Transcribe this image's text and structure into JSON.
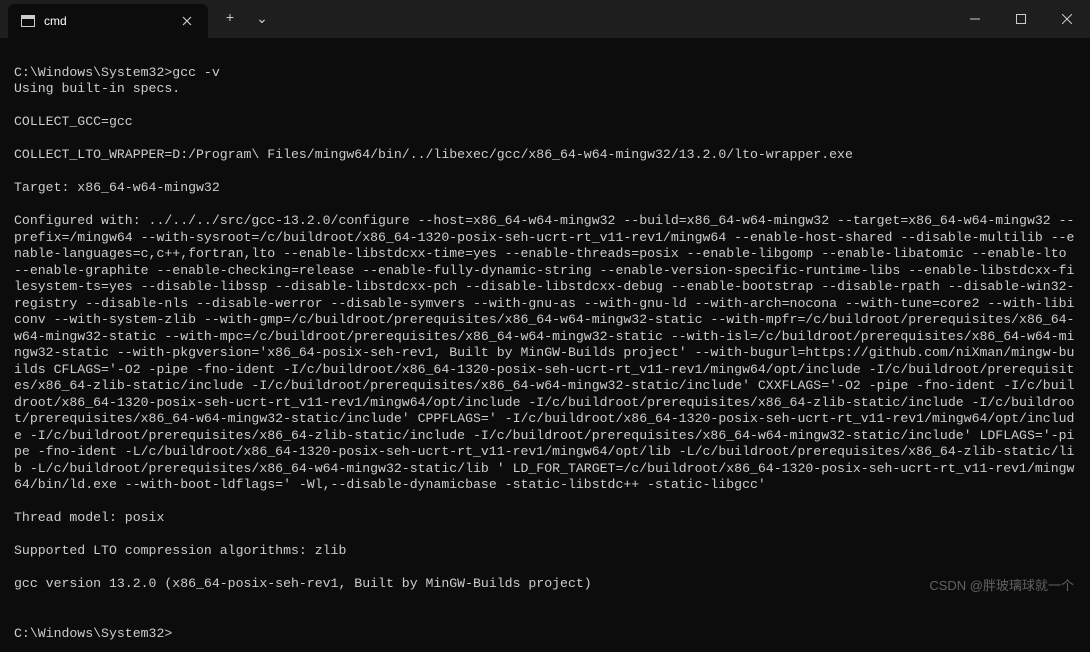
{
  "titlebar": {
    "tab_title": "cmd",
    "new_tab_label": "+",
    "dropdown_label": "⌄"
  },
  "terminal": {
    "prompt1": "C:\\Windows\\System32>",
    "command1": "gcc -v",
    "lines": [
      "Using built-in specs.",
      "COLLECT_GCC=gcc",
      "COLLECT_LTO_WRAPPER=D:/Program\\ Files/mingw64/bin/../libexec/gcc/x86_64-w64-mingw32/13.2.0/lto-wrapper.exe",
      "Target: x86_64-w64-mingw32",
      "Configured with: ../../../src/gcc-13.2.0/configure --host=x86_64-w64-mingw32 --build=x86_64-w64-mingw32 --target=x86_64-w64-mingw32 --prefix=/mingw64 --with-sysroot=/c/buildroot/x86_64-1320-posix-seh-ucrt-rt_v11-rev1/mingw64 --enable-host-shared --disable-multilib --enable-languages=c,c++,fortran,lto --enable-libstdcxx-time=yes --enable-threads=posix --enable-libgomp --enable-libatomic --enable-lto --enable-graphite --enable-checking=release --enable-fully-dynamic-string --enable-version-specific-runtime-libs --enable-libstdcxx-filesystem-ts=yes --disable-libssp --disable-libstdcxx-pch --disable-libstdcxx-debug --enable-bootstrap --disable-rpath --disable-win32-registry --disable-nls --disable-werror --disable-symvers --with-gnu-as --with-gnu-ld --with-arch=nocona --with-tune=core2 --with-libiconv --with-system-zlib --with-gmp=/c/buildroot/prerequisites/x86_64-w64-mingw32-static --with-mpfr=/c/buildroot/prerequisites/x86_64-w64-mingw32-static --with-mpc=/c/buildroot/prerequisites/x86_64-w64-mingw32-static --with-isl=/c/buildroot/prerequisites/x86_64-w64-mingw32-static --with-pkgversion='x86_64-posix-seh-rev1, Built by MinGW-Builds project' --with-bugurl=https://github.com/niXman/mingw-builds CFLAGS='-O2 -pipe -fno-ident -I/c/buildroot/x86_64-1320-posix-seh-ucrt-rt_v11-rev1/mingw64/opt/include -I/c/buildroot/prerequisites/x86_64-zlib-static/include -I/c/buildroot/prerequisites/x86_64-w64-mingw32-static/include' CXXFLAGS='-O2 -pipe -fno-ident -I/c/buildroot/x86_64-1320-posix-seh-ucrt-rt_v11-rev1/mingw64/opt/include -I/c/buildroot/prerequisites/x86_64-zlib-static/include -I/c/buildroot/prerequisites/x86_64-w64-mingw32-static/include' CPPFLAGS=' -I/c/buildroot/x86_64-1320-posix-seh-ucrt-rt_v11-rev1/mingw64/opt/include -I/c/buildroot/prerequisites/x86_64-zlib-static/include -I/c/buildroot/prerequisites/x86_64-w64-mingw32-static/include' LDFLAGS='-pipe -fno-ident -L/c/buildroot/x86_64-1320-posix-seh-ucrt-rt_v11-rev1/mingw64/opt/lib -L/c/buildroot/prerequisites/x86_64-zlib-static/lib -L/c/buildroot/prerequisites/x86_64-w64-mingw32-static/lib ' LD_FOR_TARGET=/c/buildroot/x86_64-1320-posix-seh-ucrt-rt_v11-rev1/mingw64/bin/ld.exe --with-boot-ldflags=' -Wl,--disable-dynamicbase -static-libstdc++ -static-libgcc'",
      "Thread model: posix",
      "Supported LTO compression algorithms: zlib",
      "gcc version 13.2.0 (x86_64-posix-seh-rev1, Built by MinGW-Builds project)"
    ],
    "prompt2": "C:\\Windows\\System32>"
  },
  "watermark": "CSDN @胖玻璃球就一个"
}
